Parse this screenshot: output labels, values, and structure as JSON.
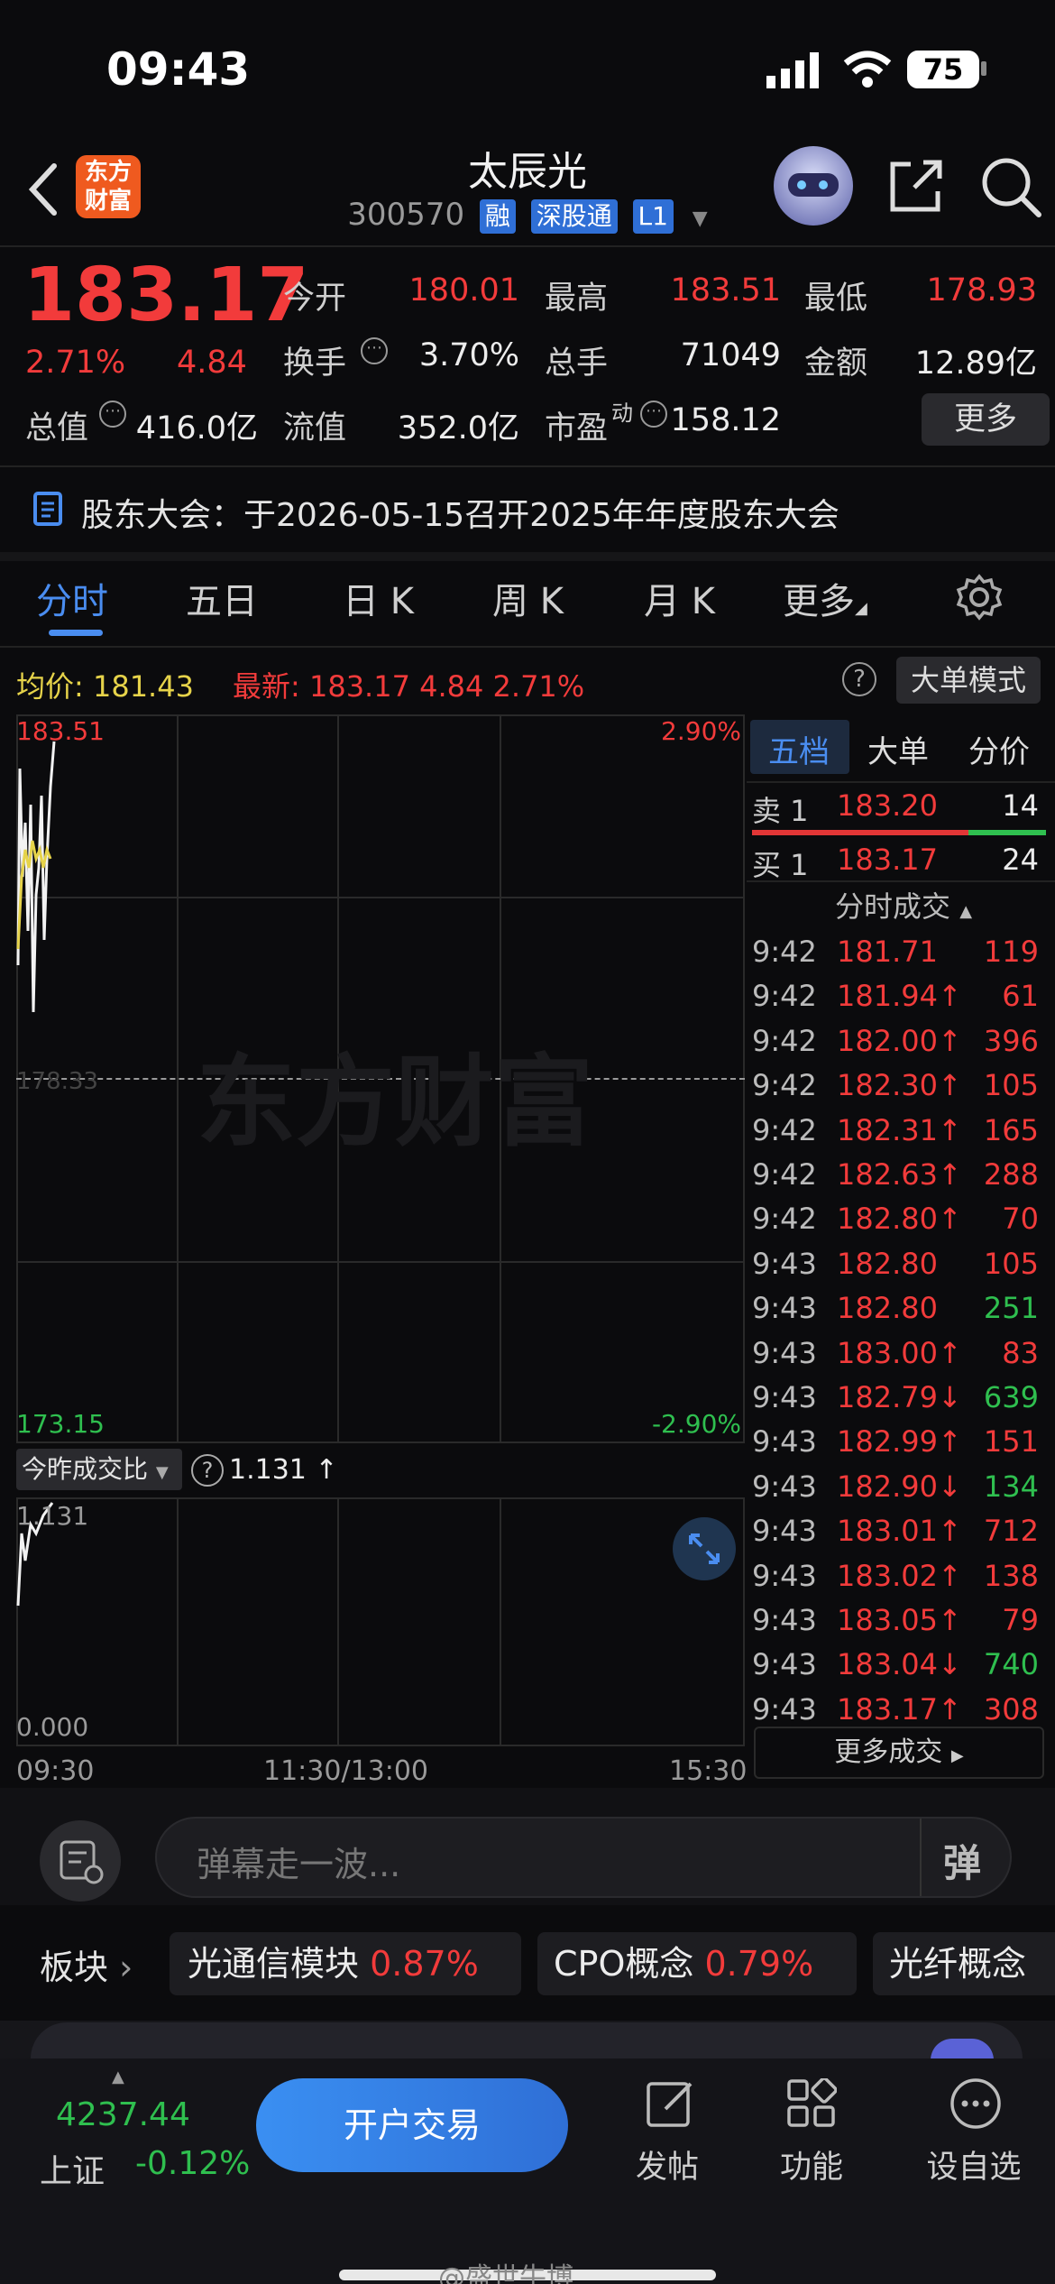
{
  "status": {
    "time": "09:43",
    "battery": "75"
  },
  "header": {
    "title": "太辰光",
    "code": "300570",
    "tags": [
      "融",
      "深股通",
      "L1"
    ],
    "logo_line1": "东方",
    "logo_line2": "财富"
  },
  "quote": {
    "price": "183.17",
    "pct": "2.71%",
    "change": "4.84",
    "open_label": "今开",
    "open": "180.01",
    "high_label": "最高",
    "high": "183.51",
    "low_label": "最低",
    "low": "178.93",
    "turnover_label": "换手",
    "turnover": "3.70%",
    "volume_label": "总手",
    "volume": "71049",
    "amount_label": "金额",
    "amount": "12.89亿",
    "mktcap_label": "总值",
    "mktcap": "416.0亿",
    "float_label": "流值",
    "float": "352.0亿",
    "pe_label": "市盈",
    "pe_sup": "动",
    "pe": "158.12",
    "more": "更多"
  },
  "notice": "股东大会：于2026-05-15召开2025年年度股东大会",
  "tabs": [
    "分时",
    "五日",
    "日 K",
    "周 K",
    "月 K",
    "更多"
  ],
  "info_bar": {
    "avg_label": "均价:",
    "avg": "181.43",
    "latest_label": "最新:",
    "latest": "183.17",
    "change": "4.84",
    "pct": "2.71%",
    "mode_button": "大单模式"
  },
  "chart": {
    "top_price": "183.51",
    "bottom_price": "173.15",
    "top_pct": "2.90%",
    "bottom_pct": "-2.90%",
    "mid_price": "178.33",
    "watermark": "东方财富",
    "ratio_selector": "今昨成交比",
    "ratio_value": "1.131",
    "ratio_top": "1.131",
    "ratio_bottom": "0.000",
    "time_start": "09:30",
    "time_mid": "11:30/13:00",
    "time_end": "15:30"
  },
  "side": {
    "tabs": [
      "五档",
      "大单",
      "分价"
    ],
    "sell1": {
      "label": "卖 1",
      "price": "183.20",
      "vol": "14"
    },
    "buy1": {
      "label": "买 1",
      "price": "183.17",
      "vol": "24"
    },
    "trades_title": "分时成交",
    "trades": [
      {
        "t": "9:42",
        "p": "181.71",
        "v": "119",
        "pc": "red",
        "vc": "red"
      },
      {
        "t": "9:42",
        "p": "181.94↑",
        "v": "61",
        "pc": "red",
        "vc": "red"
      },
      {
        "t": "9:42",
        "p": "182.00↑",
        "v": "396",
        "pc": "red",
        "vc": "red"
      },
      {
        "t": "9:42",
        "p": "182.30↑",
        "v": "105",
        "pc": "red",
        "vc": "red"
      },
      {
        "t": "9:42",
        "p": "182.31↑",
        "v": "165",
        "pc": "red",
        "vc": "red"
      },
      {
        "t": "9:42",
        "p": "182.63↑",
        "v": "288",
        "pc": "red",
        "vc": "red"
      },
      {
        "t": "9:42",
        "p": "182.80↑",
        "v": "70",
        "pc": "red",
        "vc": "red"
      },
      {
        "t": "9:43",
        "p": "182.80",
        "v": "105",
        "pc": "red",
        "vc": "red"
      },
      {
        "t": "9:43",
        "p": "182.80",
        "v": "251",
        "pc": "red",
        "vc": "green"
      },
      {
        "t": "9:43",
        "p": "183.00↑",
        "v": "83",
        "pc": "red",
        "vc": "red"
      },
      {
        "t": "9:43",
        "p": "182.79↓",
        "v": "639",
        "pc": "red",
        "vc": "green"
      },
      {
        "t": "9:43",
        "p": "182.99↑",
        "v": "151",
        "pc": "red",
        "vc": "red"
      },
      {
        "t": "9:43",
        "p": "182.90↓",
        "v": "134",
        "pc": "red",
        "vc": "green"
      },
      {
        "t": "9:43",
        "p": "183.01↑",
        "v": "712",
        "pc": "red",
        "vc": "red"
      },
      {
        "t": "9:43",
        "p": "183.02↑",
        "v": "138",
        "pc": "red",
        "vc": "red"
      },
      {
        "t": "9:43",
        "p": "183.05↑",
        "v": "79",
        "pc": "red",
        "vc": "red"
      },
      {
        "t": "9:43",
        "p": "183.04↓",
        "v": "740",
        "pc": "red",
        "vc": "green"
      },
      {
        "t": "9:43",
        "p": "183.17↑",
        "v": "308",
        "pc": "red",
        "vc": "red"
      }
    ],
    "more_trades": "更多成交"
  },
  "danmaku": {
    "placeholder": "弹幕走一波...",
    "send": "弹"
  },
  "sectors": {
    "label": "板块",
    "items": [
      {
        "name": "光通信模块",
        "pct": "0.87%"
      },
      {
        "name": "CPO概念",
        "pct": "0.79%"
      },
      {
        "name": "光纤概念",
        "pct": ""
      }
    ]
  },
  "bottom": {
    "index_value": "4237.44",
    "index_name": "上证",
    "index_pct": "-0.12%",
    "trade_button": "开户交易",
    "post": "发帖",
    "functions": "功能",
    "watchlist": "设自选"
  },
  "watermark": "@盛世牛博"
}
